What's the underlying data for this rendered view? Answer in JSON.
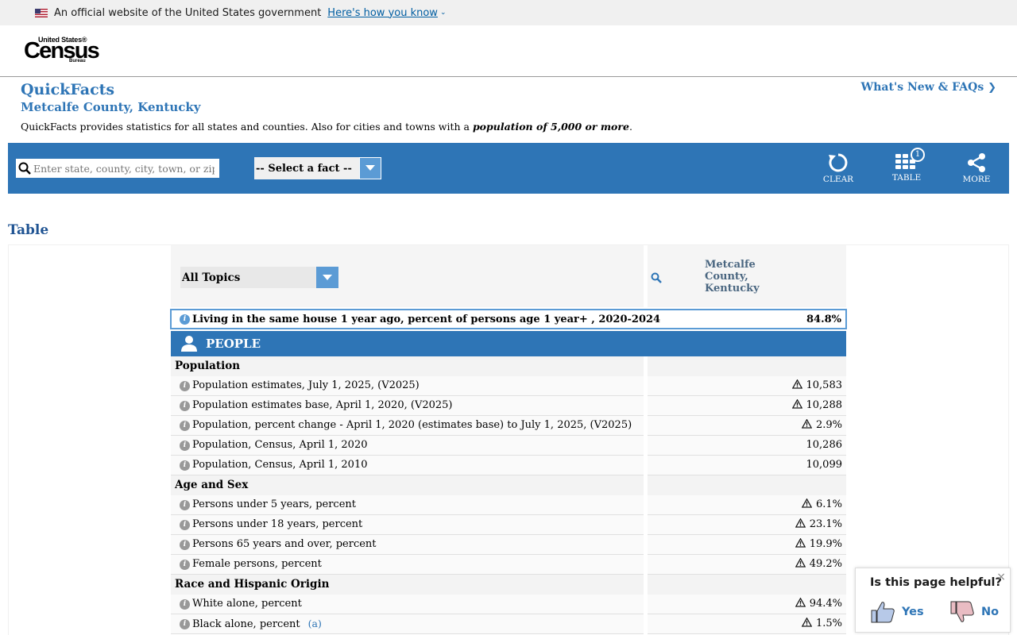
{
  "gov_banner": {
    "text": "An official website of the United States government",
    "link": "Here's how you know"
  },
  "logo": {
    "top": "United States®",
    "main": "Census",
    "bottom": "Bureau"
  },
  "quickfacts": {
    "title": "QuickFacts",
    "location": "Metcalfe County, Kentucky",
    "description_prefix": "QuickFacts provides statistics for all states and counties. Also for cities and towns with a ",
    "description_emph": "population of 5,000 or more",
    "description_suffix": ".",
    "whats_new": "What's New & FAQs"
  },
  "toolbar": {
    "search_placeholder": "Enter state, county, city, town, or zip code",
    "select_fact": "-- Select a fact --",
    "clear": "CLEAR",
    "table": "TABLE",
    "table_badge": "1",
    "more": "MORE"
  },
  "table_heading": "Table",
  "table": {
    "topics_label": "All Topics",
    "column_header": [
      "Metcalfe",
      "County,",
      "Kentucky"
    ],
    "highlight": {
      "label": "Living in the same house 1 year ago, percent of persons age 1 year+ , 2020-2024",
      "value": "84.8%"
    },
    "section": "PEOPLE",
    "groups": [
      {
        "title": "Population",
        "rows": [
          {
            "label": "Population estimates, July 1, 2025, (V2025)",
            "value": "10,583",
            "flag": true
          },
          {
            "label": "Population estimates base, April 1, 2020, (V2025)",
            "value": "10,288",
            "flag": true
          },
          {
            "label": "Population, percent change - April 1, 2020 (estimates base) to July 1, 2025, (V2025)",
            "value": "2.9%",
            "flag": true
          },
          {
            "label": "Population, Census, April 1, 2020",
            "value": "10,286",
            "flag": false
          },
          {
            "label": "Population, Census, April 1, 2010",
            "value": "10,099",
            "flag": false
          }
        ]
      },
      {
        "title": "Age and Sex",
        "rows": [
          {
            "label": "Persons under 5 years, percent",
            "value": "6.1%",
            "flag": true
          },
          {
            "label": "Persons under 18 years, percent",
            "value": "23.1%",
            "flag": true
          },
          {
            "label": "Persons 65 years and over, percent",
            "value": "19.9%",
            "flag": true
          },
          {
            "label": "Female persons, percent",
            "value": "49.2%",
            "flag": true
          }
        ]
      },
      {
        "title": "Race and Hispanic Origin",
        "rows": [
          {
            "label": "White alone, percent",
            "value": "94.4%",
            "flag": true
          },
          {
            "label": "Black alone, percent",
            "note": "(a)",
            "value": "1.5%",
            "flag": true
          }
        ]
      }
    ]
  },
  "feedback": {
    "question": "Is this page helpful?",
    "yes": "Yes",
    "no": "No",
    "close": "×"
  },
  "colors": {
    "primary": "#2e75b6",
    "accent": "#5b9bd5",
    "heading": "#205493"
  }
}
